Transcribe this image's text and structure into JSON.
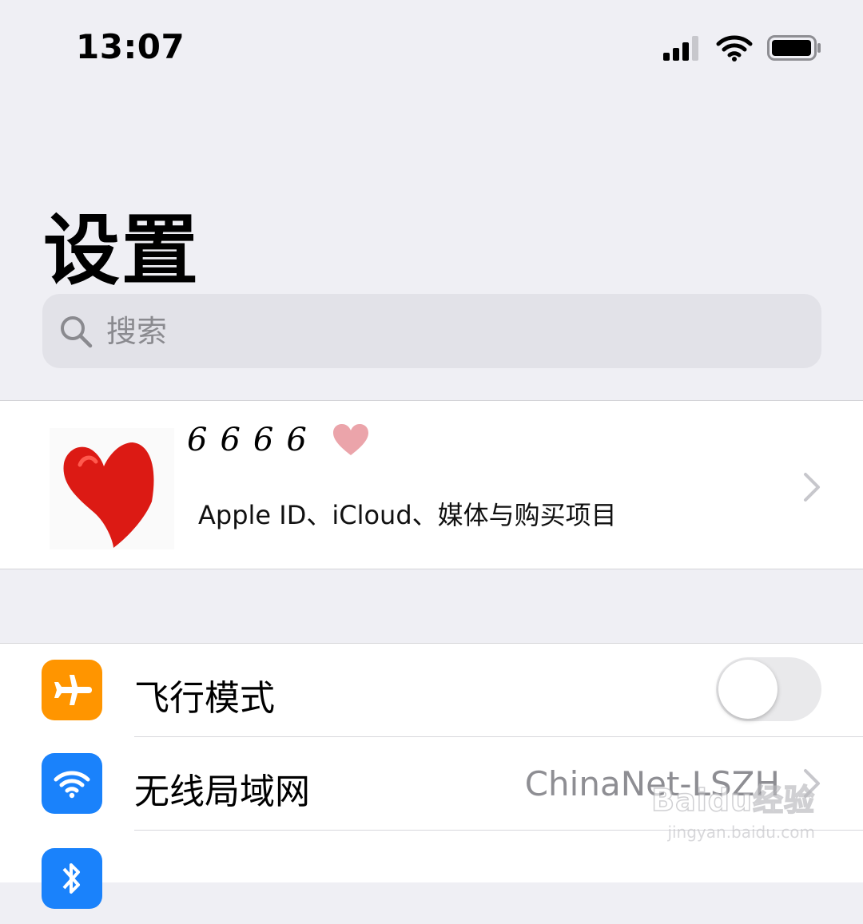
{
  "status_bar": {
    "time": "13:07"
  },
  "header": {
    "title": "设置"
  },
  "search": {
    "placeholder": "搜索"
  },
  "profile": {
    "name": "6666",
    "subtitle": "Apple ID、iCloud、媒体与购买项目"
  },
  "settings": {
    "items": [
      {
        "label": "飞行模式",
        "icon": "airplane-icon",
        "icon_color": "#ff9500",
        "toggle_on": false
      },
      {
        "label": "无线局域网",
        "value": "ChinaNet-LSZH",
        "icon": "wifi-icon",
        "icon_color": "#1a82fb"
      },
      {
        "icon": "bluetooth-icon",
        "icon_color": "#1a82fb"
      }
    ]
  },
  "watermark": {
    "logo": "Baidu经验",
    "url": "jingyan.baidu.com"
  }
}
